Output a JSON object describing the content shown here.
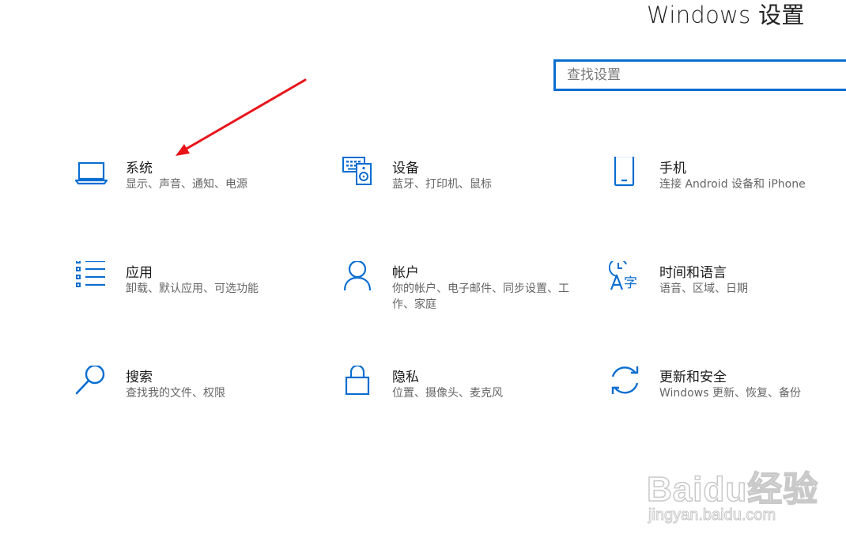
{
  "header": {
    "title": "Windows 设置"
  },
  "search": {
    "placeholder": "查找设置",
    "value": ""
  },
  "tiles": [
    {
      "title": "系统",
      "desc": "显示、声音、通知、电源",
      "icon": "laptop-icon"
    },
    {
      "title": "设备",
      "desc": "蓝牙、打印机、鼠标",
      "icon": "keyboard-speaker-icon"
    },
    {
      "title": "手机",
      "desc": "连接 Android 设备和 iPhone",
      "icon": "phone-icon"
    },
    {
      "title": "应用",
      "desc": "卸载、默认应用、可选功能",
      "icon": "apps-list-icon"
    },
    {
      "title": "帐户",
      "desc": "你的帐户、电子邮件、同步设置、工作、家庭",
      "icon": "person-icon"
    },
    {
      "title": "时间和语言",
      "desc": "语音、区域、日期",
      "icon": "time-language-icon"
    },
    {
      "title": "搜索",
      "desc": "查找我的文件、权限",
      "icon": "search-icon"
    },
    {
      "title": "隐私",
      "desc": "位置、摄像头、麦克风",
      "icon": "lock-icon"
    },
    {
      "title": "更新和安全",
      "desc": "Windows 更新、恢复、备份",
      "icon": "sync-icon"
    }
  ],
  "watermark": {
    "logo": "Baidu经验",
    "url": "jingyan.baidu.com"
  },
  "colors": {
    "accent": "#0a6ed1",
    "annotation_arrow": "#e8141b"
  }
}
